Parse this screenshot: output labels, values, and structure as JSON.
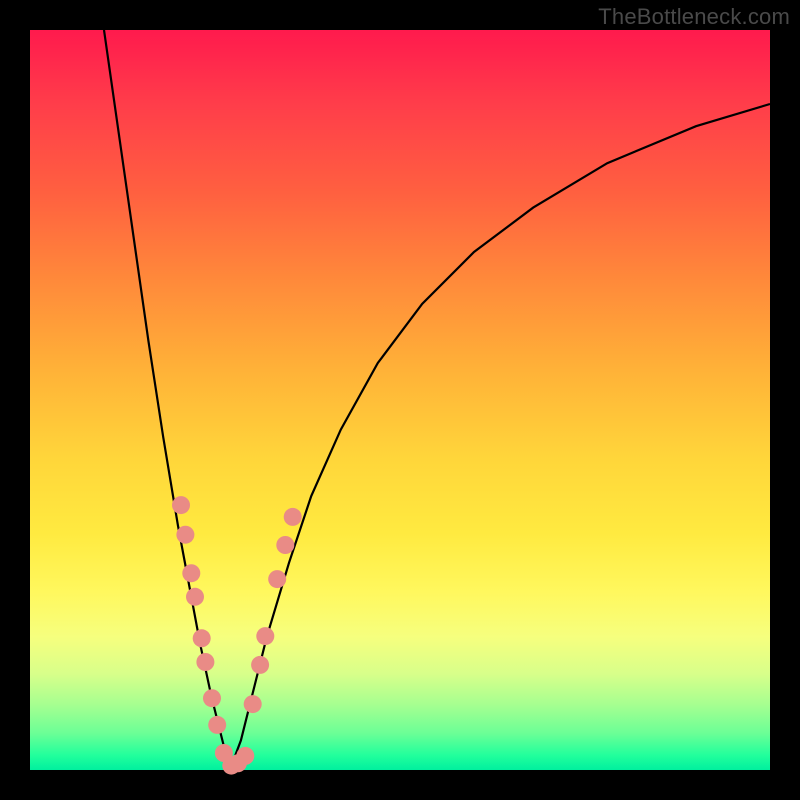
{
  "watermark": "TheBottleneck.com",
  "chart_data": {
    "type": "line",
    "title": "",
    "xlabel": "",
    "ylabel": "",
    "xlim": [
      0,
      100
    ],
    "ylim": [
      0,
      100
    ],
    "curve_left": {
      "x": [
        10,
        12,
        14,
        16,
        18,
        20,
        21.5,
        23,
        24.5,
        26,
        27
      ],
      "y": [
        100,
        86,
        72,
        58,
        45,
        33,
        25,
        17,
        10,
        4,
        0
      ]
    },
    "curve_right": {
      "x": [
        27,
        28.5,
        30,
        32,
        35,
        38,
        42,
        47,
        53,
        60,
        68,
        78,
        90,
        100
      ],
      "y": [
        0,
        4,
        10,
        18,
        28,
        37,
        46,
        55,
        63,
        70,
        76,
        82,
        87,
        90
      ]
    },
    "series": [
      {
        "name": "markers",
        "points": [
          {
            "x": 20.4,
            "y": 35.8
          },
          {
            "x": 21.0,
            "y": 31.8
          },
          {
            "x": 21.8,
            "y": 26.6
          },
          {
            "x": 22.3,
            "y": 23.4
          },
          {
            "x": 23.2,
            "y": 17.8
          },
          {
            "x": 23.7,
            "y": 14.6
          },
          {
            "x": 24.6,
            "y": 9.7
          },
          {
            "x": 25.3,
            "y": 6.1
          },
          {
            "x": 26.2,
            "y": 2.3
          },
          {
            "x": 27.2,
            "y": 0.6
          },
          {
            "x": 28.1,
            "y": 0.9
          },
          {
            "x": 29.1,
            "y": 1.9
          },
          {
            "x": 30.1,
            "y": 8.9
          },
          {
            "x": 31.1,
            "y": 14.2
          },
          {
            "x": 31.8,
            "y": 18.1
          },
          {
            "x": 33.4,
            "y": 25.8
          },
          {
            "x": 34.5,
            "y": 30.4
          },
          {
            "x": 35.5,
            "y": 34.2
          }
        ]
      }
    ],
    "dot_radius_px": 9
  },
  "colors": {
    "dot": "#e98b86",
    "curve": "#000000",
    "frame": "#000000"
  }
}
